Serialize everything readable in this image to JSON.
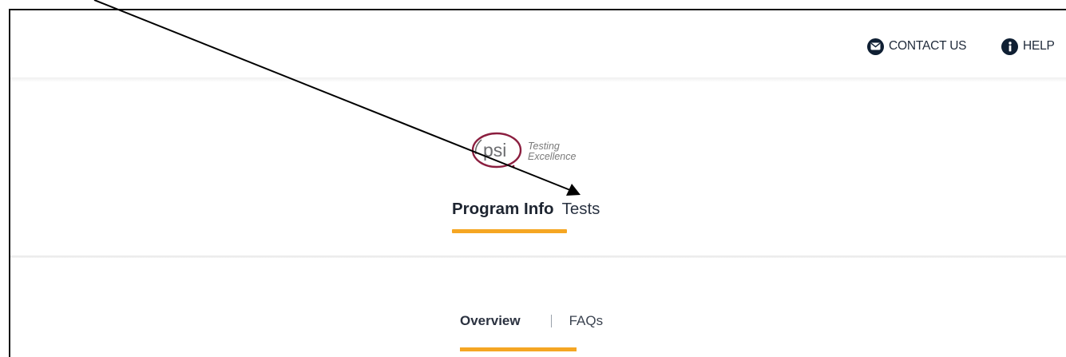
{
  "header": {
    "contact_label": "CONTACT US",
    "help_label": "HELP"
  },
  "logo": {
    "mark": "psi",
    "tagline_line1": "Testing",
    "tagline_line2": "Excellence",
    "brand_color": "#8b1e3f"
  },
  "main_tabs": {
    "items": [
      {
        "label": "Program Info",
        "active": true
      },
      {
        "label": "Tests",
        "active": false
      }
    ]
  },
  "sub_tabs": {
    "items": [
      {
        "label": "Overview",
        "active": true
      },
      {
        "label": "FAQs",
        "active": false
      }
    ]
  },
  "colors": {
    "accent": "#f5a623",
    "icon_dark": "#0f1f33",
    "text": "#2a3342"
  }
}
